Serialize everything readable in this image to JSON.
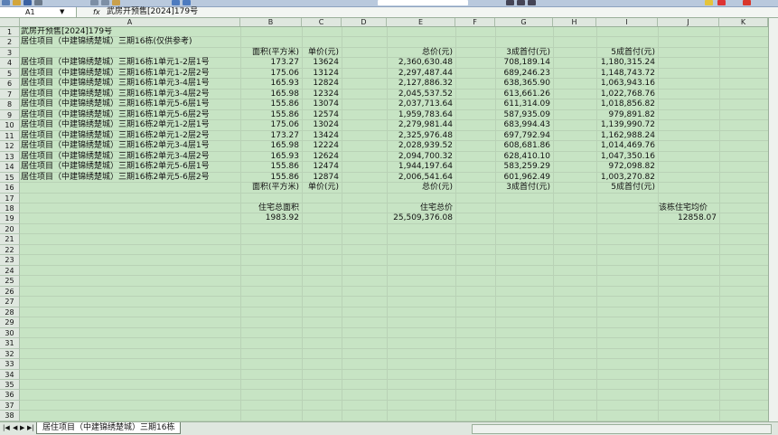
{
  "formula_bar": {
    "cell_ref": "A1",
    "fx_label": "fx",
    "content": "武房开预售[2024]179号"
  },
  "columns": [
    "A",
    "B",
    "C",
    "D",
    "E",
    "F",
    "G",
    "H",
    "I",
    "J",
    "K"
  ],
  "rows": {
    "1": {
      "A": "武房开预售[2024]179号"
    },
    "2": {
      "A": "居住项目（中建锦绣楚城）三期16栋(仅供参考)"
    },
    "3": {
      "B": "面积(平方米)",
      "C": "单价(元)",
      "E": "总价(元)",
      "G": "3成首付(元)",
      "I": "5成首付(元)"
    },
    "4": {
      "A": "居住项目（中建锦绣楚城）三期16栋1单元1-2层1号",
      "B": "173.27",
      "C": "13624",
      "E": "2,360,630.48",
      "G": "708,189.14",
      "I": "1,180,315.24"
    },
    "5": {
      "A": "居住项目（中建锦绣楚城）三期16栋1单元1-2层2号",
      "B": "175.06",
      "C": "13124",
      "E": "2,297,487.44",
      "G": "689,246.23",
      "I": "1,148,743.72"
    },
    "6": {
      "A": "居住项目（中建锦绣楚城）三期16栋1单元3-4层1号",
      "B": "165.93",
      "C": "12824",
      "E": "2,127,886.32",
      "G": "638,365.90",
      "I": "1,063,943.16"
    },
    "7": {
      "A": "居住项目（中建锦绣楚城）三期16栋1单元3-4层2号",
      "B": "165.98",
      "C": "12324",
      "E": "2,045,537.52",
      "G": "613,661.26",
      "I": "1,022,768.76"
    },
    "8": {
      "A": "居住项目（中建锦绣楚城）三期16栋1单元5-6层1号",
      "B": "155.86",
      "C": "13074",
      "E": "2,037,713.64",
      "G": "611,314.09",
      "I": "1,018,856.82"
    },
    "9": {
      "A": "居住项目（中建锦绣楚城）三期16栋1单元5-6层2号",
      "B": "155.86",
      "C": "12574",
      "E": "1,959,783.64",
      "G": "587,935.09",
      "I": "979,891.82"
    },
    "10": {
      "A": "居住项目（中建锦绣楚城）三期16栋2单元1-2层1号",
      "B": "175.06",
      "C": "13024",
      "E": "2,279,981.44",
      "G": "683,994.43",
      "I": "1,139,990.72"
    },
    "11": {
      "A": "居住项目（中建锦绣楚城）三期16栋2单元1-2层2号",
      "B": "173.27",
      "C": "13424",
      "E": "2,325,976.48",
      "G": "697,792.94",
      "I": "1,162,988.24"
    },
    "12": {
      "A": "居住项目（中建锦绣楚城）三期16栋2单元3-4层1号",
      "B": "165.98",
      "C": "12224",
      "E": "2,028,939.52",
      "G": "608,681.86",
      "I": "1,014,469.76"
    },
    "13": {
      "A": "居住项目（中建锦绣楚城）三期16栋2单元3-4层2号",
      "B": "165.93",
      "C": "12624",
      "E": "2,094,700.32",
      "G": "628,410.10",
      "I": "1,047,350.16"
    },
    "14": {
      "A": "居住项目（中建锦绣楚城）三期16栋2单元5-6层1号",
      "B": "155.86",
      "C": "12474",
      "E": "1,944,197.64",
      "G": "583,259.29",
      "I": "972,098.82"
    },
    "15": {
      "A": "居住项目（中建锦绣楚城）三期16栋2单元5-6层2号",
      "B": "155.86",
      "C": "12874",
      "E": "2,006,541.64",
      "G": "601,962.49",
      "I": "1,003,270.82"
    },
    "16": {
      "B": "面积(平方米)",
      "C": "单价(元)",
      "E": "总价(元)",
      "G": "3成首付(元)",
      "I": "5成首付(元)"
    },
    "18": {
      "B": "住宅总面积",
      "E": "住宅总价",
      "J": "该栋住宅均价"
    },
    "19": {
      "B": "1983.92",
      "E": "25,509,376.08",
      "J": "12858.07"
    }
  },
  "row_count": 38,
  "sheet_tab": {
    "label": "居住项目（中建锦绣楚城）三期16栋"
  },
  "colors": {
    "grid_bg": "#c7e4c4",
    "header_bg": "#dfe7df",
    "toolbar_bg": "#b9c9dd"
  }
}
